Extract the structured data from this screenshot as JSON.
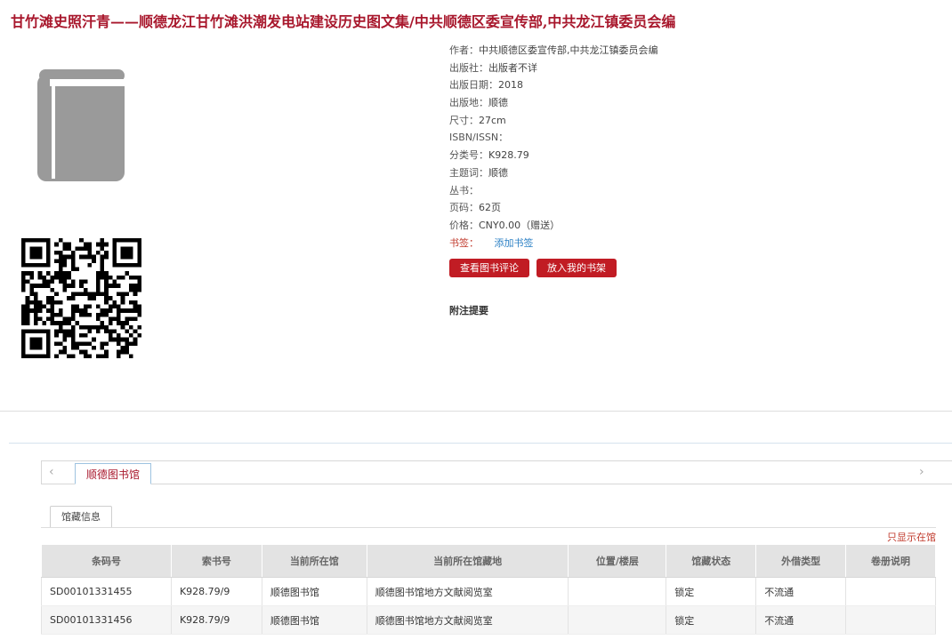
{
  "title": "甘竹滩史照汗青——顺德龙江甘竹滩洪潮发电站建设历史图文集/中共顺德区委宣传部,中共龙江镇委员会编",
  "meta": [
    {
      "label": "作者：",
      "value": "中共顺德区委宣传部,中共龙江镇委员会编"
    },
    {
      "label": "出版社：",
      "value": "出版者不详"
    },
    {
      "label": "出版日期：",
      "value": "2018"
    },
    {
      "label": "出版地：",
      "value": "顺德"
    },
    {
      "label": "尺寸：",
      "value": "27cm"
    },
    {
      "label": "ISBN/ISSN：",
      "value": ""
    },
    {
      "label": "分类号：",
      "value": "K928.79"
    },
    {
      "label": "主题词：",
      "value": "顺德"
    },
    {
      "label": "丛书：",
      "value": ""
    },
    {
      "label": "页码：",
      "value": "62页"
    },
    {
      "label": "价格：",
      "value": "CNY0.00（赠送）"
    }
  ],
  "bookmark": {
    "label": "书签：",
    "link": "添加书签"
  },
  "buttons": {
    "review": "查看图书评论",
    "shelf": "放入我的书架"
  },
  "notes_label": "附注提要",
  "library_tab": "顺德图书馆",
  "holdings_tab": "馆藏信息",
  "only_in_library": "只显示在馆",
  "nav": {
    "left": "‹",
    "right": "›"
  },
  "table": {
    "headers": [
      "条码号",
      "索书号",
      "当前所在馆",
      "当前所在馆藏地",
      "位置/楼层",
      "馆藏状态",
      "外借类型",
      "卷册说明"
    ],
    "rows": [
      [
        "SD00101331455",
        "K928.79/9",
        "顺德图书馆",
        "顺德图书馆地方文献阅览室",
        "",
        "锁定",
        "不流通",
        ""
      ],
      [
        "SD00101331456",
        "K928.79/9",
        "顺德图书馆",
        "顺德图书馆地方文献阅览室",
        "",
        "锁定",
        "不流通",
        ""
      ]
    ]
  },
  "colors": {
    "accent": "#a8172c",
    "button": "#c11c24",
    "link": "#2a7fc4"
  },
  "icons": {
    "cover": "book-icon",
    "qr": "qr-code"
  }
}
